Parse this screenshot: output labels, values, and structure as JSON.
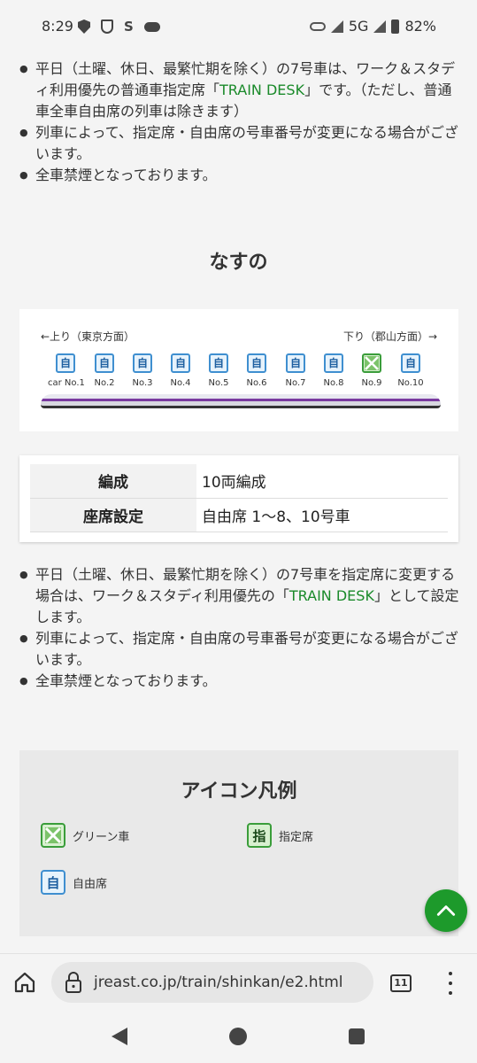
{
  "status": {
    "time": "8:29",
    "network": "5G",
    "battery": "82%"
  },
  "notes_top": [
    {
      "pre": "平日（土曜、休日、最繁忙期を除く）の7号車は、ワーク＆スタディ利用優先の普通車指定席「",
      "link": "TRAIN DESK",
      "post": "」です。（ただし、普通車全車自由席の列車は除きます）"
    },
    {
      "pre": "列車によって、指定席・自由席の号車番号が変更になる場合がございます。",
      "link": "",
      "post": ""
    },
    {
      "pre": "全車禁煙となっております。",
      "link": "",
      "post": ""
    }
  ],
  "section_title": "なすの",
  "diagram": {
    "dir_left": "←上り（東京方面）",
    "dir_right": "下り（郡山方面）→",
    "cars": [
      {
        "label": "car No.1",
        "type": "自"
      },
      {
        "label": "No.2",
        "type": "自"
      },
      {
        "label": "No.3",
        "type": "自"
      },
      {
        "label": "No.4",
        "type": "自"
      },
      {
        "label": "No.5",
        "type": "自"
      },
      {
        "label": "No.6",
        "type": "自"
      },
      {
        "label": "No.7",
        "type": "自"
      },
      {
        "label": "No.8",
        "type": "自"
      },
      {
        "label": "No.9",
        "type": "green"
      },
      {
        "label": "No.10",
        "type": "自"
      }
    ]
  },
  "info_table": [
    {
      "key": "編成",
      "value": "10両編成"
    },
    {
      "key": "座席設定",
      "value": "自由席 1〜8、10号車"
    }
  ],
  "notes_bottom": [
    {
      "pre": "平日（土曜、休日、最繁忙期を除く）の7号車を指定席に変更する場合は、ワーク＆スタディ利用優先の「",
      "link": "TRAIN DESK",
      "post": "」として設定します。"
    },
    {
      "pre": "列車によって、指定席・自由席の号車番号が変更になる場合がございます。",
      "link": "",
      "post": ""
    },
    {
      "pre": "全車禁煙となっております。",
      "link": "",
      "post": ""
    }
  ],
  "legend": {
    "title": "アイコン凡例",
    "items": [
      {
        "icon": "green-car-icon",
        "text": "グリーン車"
      },
      {
        "icon": "reserved-seat-icon",
        "glyph": "指",
        "text": "指定席"
      },
      {
        "icon": "free-seat-icon",
        "glyph": "自",
        "text": "自由席"
      }
    ]
  },
  "browser": {
    "url": "jreast.co.jp/train/shinkan/e2.html",
    "tab_count": "11"
  },
  "colors": {
    "link_green": "#1a8a2a",
    "fab_green": "#1d9a2b",
    "free_seat_blue": "#3f8fd0"
  }
}
